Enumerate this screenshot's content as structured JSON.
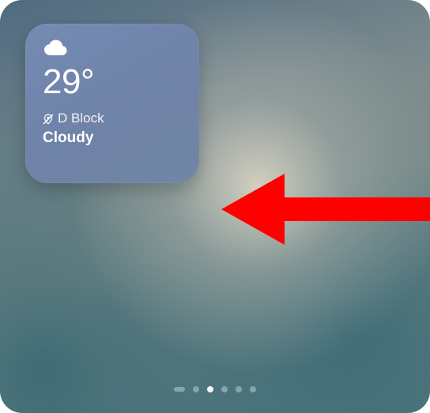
{
  "weather_widget": {
    "icon": "cloud-icon",
    "temperature": "29°",
    "location_icon": "location-off-icon",
    "location": "D Block",
    "condition": "Cloudy"
  },
  "annotation": {
    "arrow_color": "#ff0000"
  },
  "pagination": {
    "count": 6,
    "active_index": 2
  }
}
